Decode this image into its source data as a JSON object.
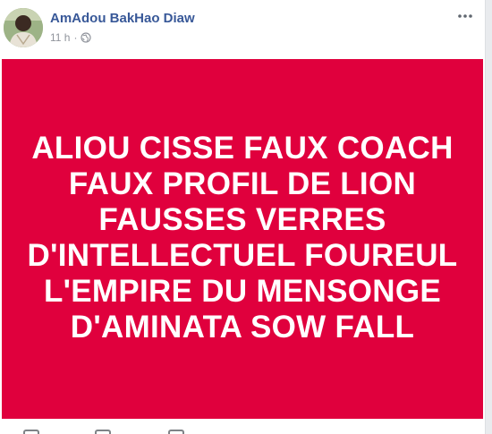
{
  "post": {
    "author_name": "AmAdou BakHao Diaw",
    "timestamp": "11 h",
    "separator": "·",
    "privacy_icon": "globe-icon",
    "menu_icon": "more-options-icon"
  },
  "banner": {
    "background_color": "#e0003d",
    "text_color": "#ffffff",
    "lines": [
      "ALIOU CISSE FAUX COACH",
      "FAUX PROFIL DE LION",
      "FAUSSES VERRES",
      "D'INTELLECTUEL FOUREUL",
      "L'EMPIRE DU MENSONGE",
      "D'AMINATA SOW FALL"
    ]
  },
  "footer": {
    "icons": [
      "like-icon",
      "comment-icon",
      "share-icon"
    ]
  }
}
